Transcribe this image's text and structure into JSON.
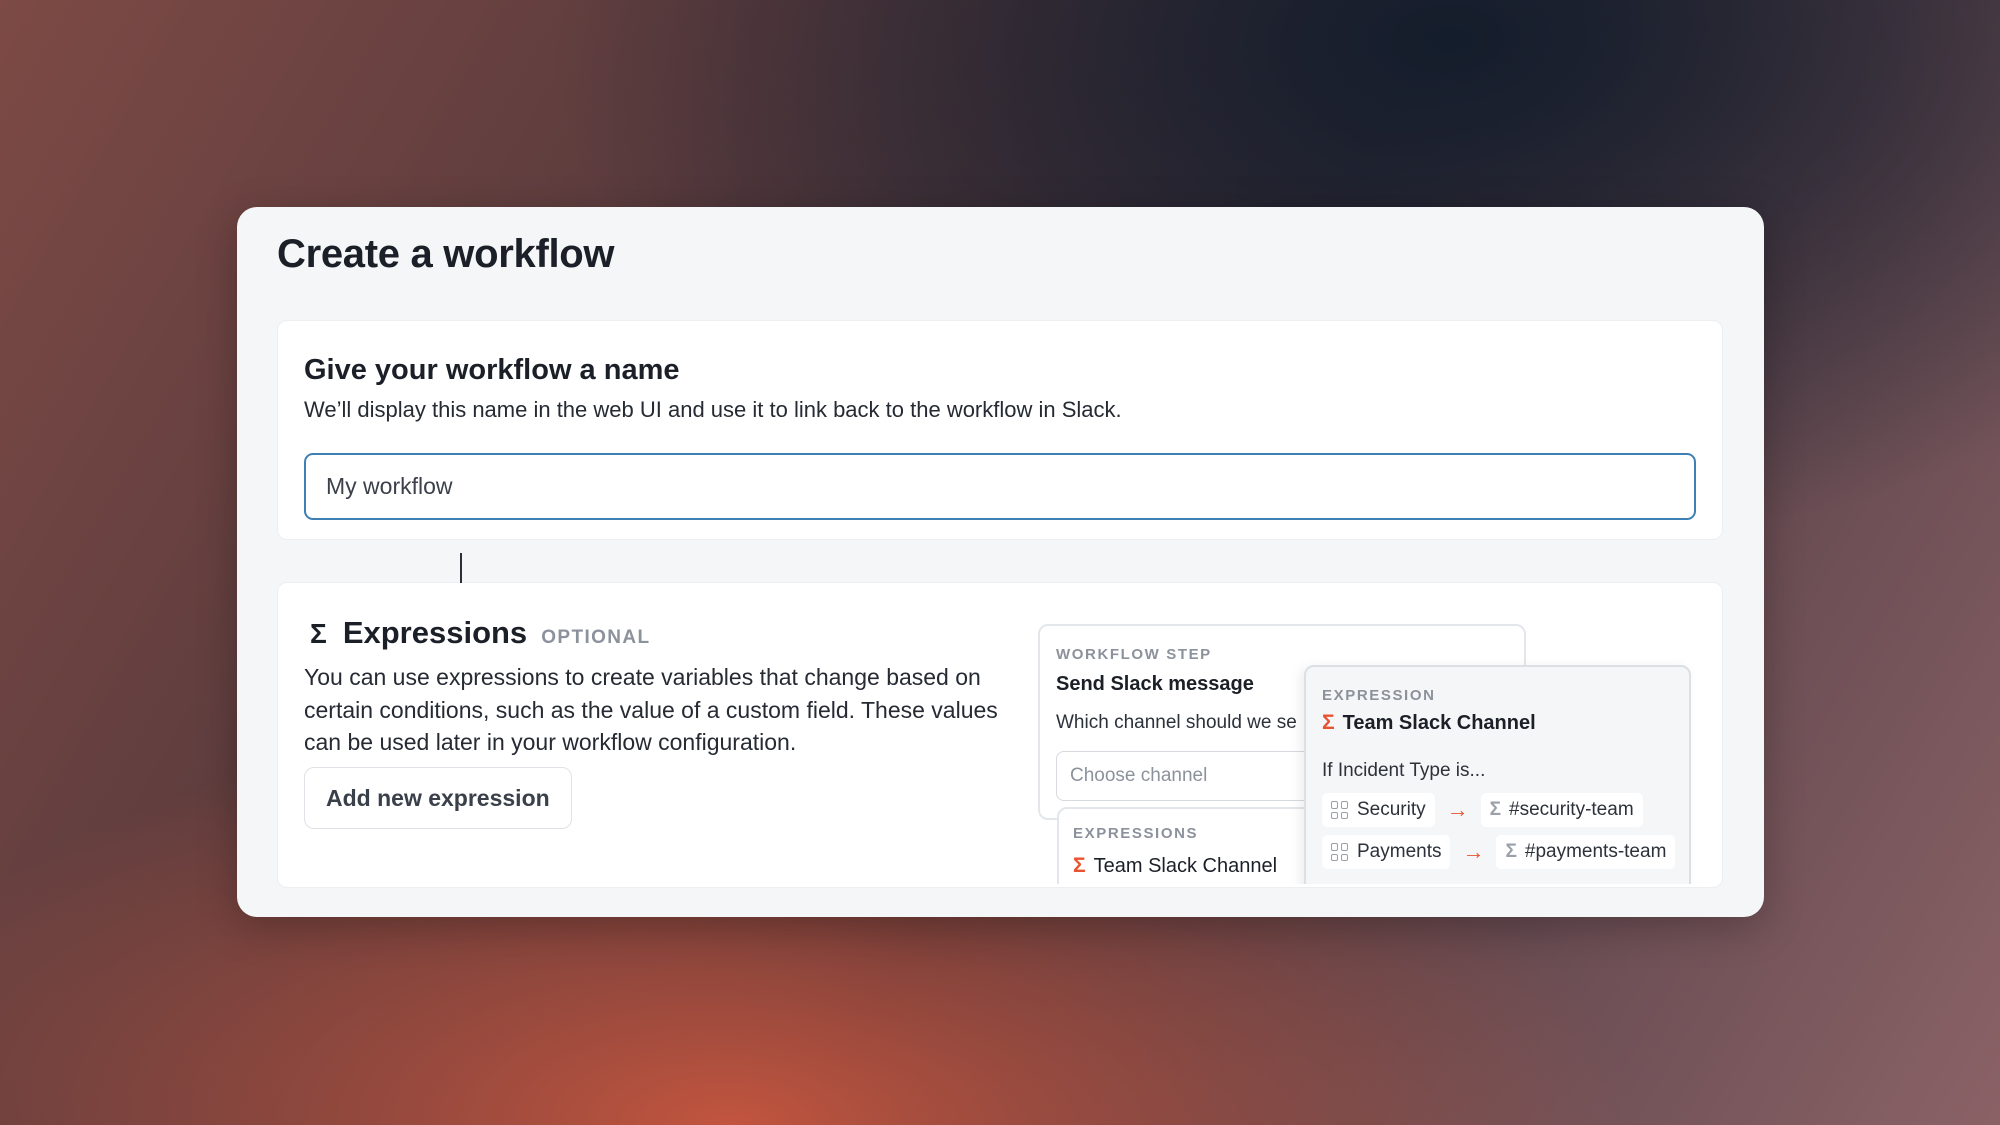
{
  "page": {
    "title": "Create a workflow"
  },
  "name_section": {
    "heading": "Give your workflow a name",
    "description": "We’ll display this name in the web UI and use it to link back to the workflow in Slack.",
    "input_value": "My workflow"
  },
  "expressions_section": {
    "icon": "sigma-icon",
    "heading": "Expressions",
    "badge": "OPTIONAL",
    "description": "You can use expressions to create variables that change based on certain conditions, such as the value of a custom field. These values can be used later in your workflow configuration.",
    "add_button_label": "Add new expression"
  },
  "workflow_step_card": {
    "label": "WORKFLOW STEP",
    "title": "Send Slack message",
    "question": "Which channel should we se",
    "select_placeholder": "Choose channel"
  },
  "expressions_mini_card": {
    "label": "EXPRESSIONS",
    "value": "Team Slack Channel"
  },
  "expression_card": {
    "label": "EXPRESSION",
    "title": "Team Slack Channel",
    "condition": "If Incident Type is...",
    "rules": [
      {
        "match": "Security",
        "result": "#security-team"
      },
      {
        "match": "Payments",
        "result": "#payments-team"
      }
    ]
  },
  "colors": {
    "accent": "#e8542f",
    "input_border": "#3f80b4"
  }
}
